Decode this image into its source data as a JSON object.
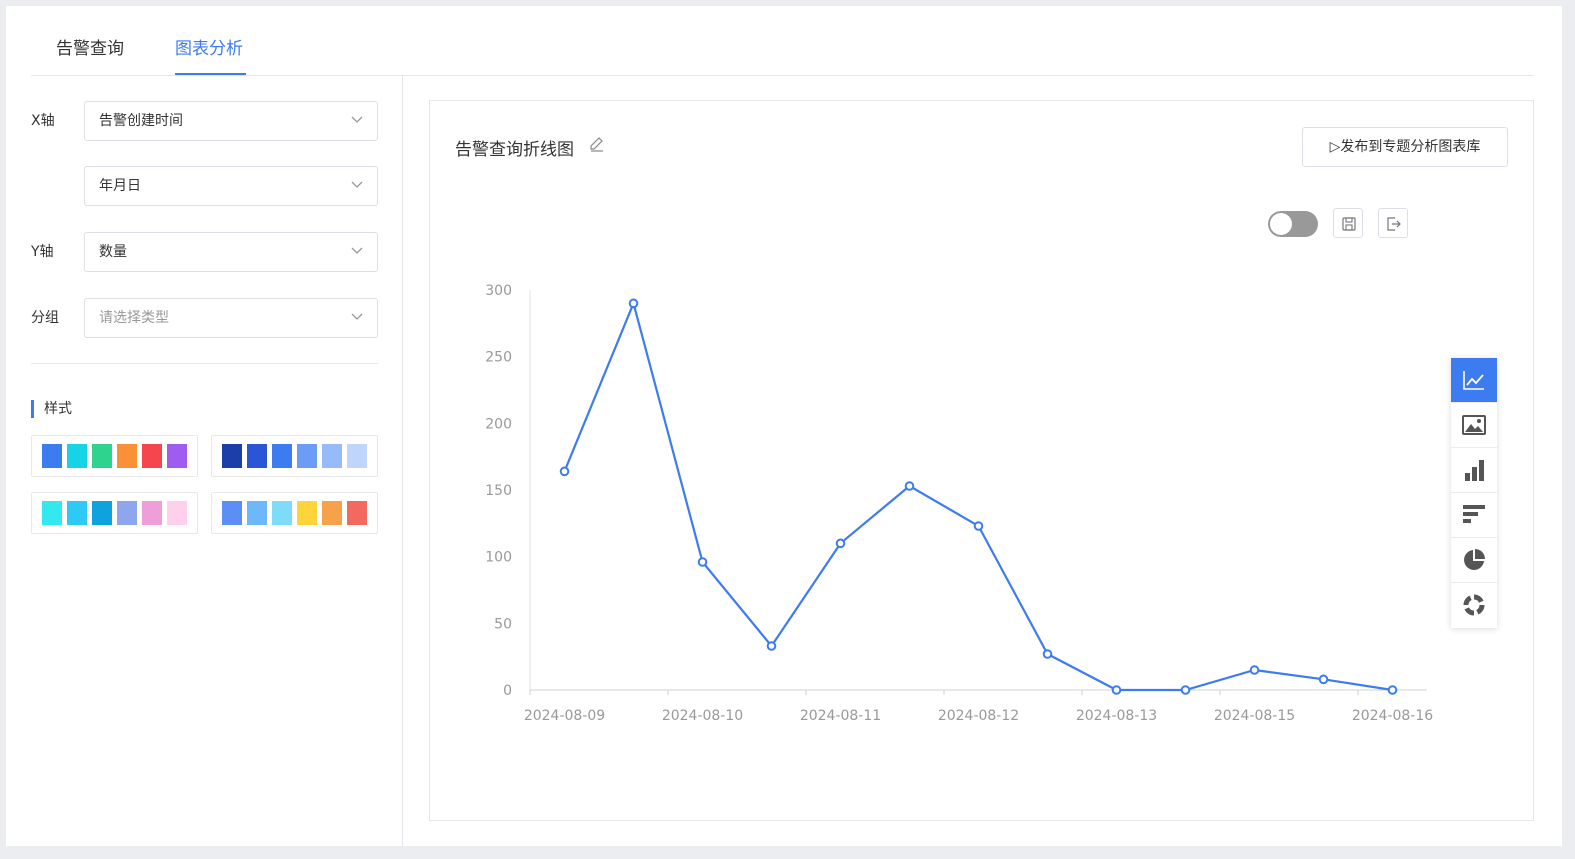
{
  "tabs": [
    {
      "label": "告警查询",
      "active": false
    },
    {
      "label": "图表分析",
      "active": true
    }
  ],
  "form": {
    "x_axis_label": "X轴",
    "x_axis_value": "告警创建时间",
    "x_axis_granularity": "年月日",
    "y_axis_label": "Y轴",
    "y_axis_value": "数量",
    "group_label": "分组",
    "group_placeholder": "请选择类型"
  },
  "style": {
    "title": "样式",
    "palettes": [
      [
        "#3d7bf0",
        "#16d3e6",
        "#2ed38e",
        "#fa9136",
        "#f6464d",
        "#a05bf0"
      ],
      [
        "#1b3ea8",
        "#2955d6",
        "#3d7bf0",
        "#6b9cf6",
        "#96bbf8",
        "#bfd5fb"
      ],
      [
        "#33e8ee",
        "#2fc9f5",
        "#0ea2de",
        "#8ea6ee",
        "#ee9fda",
        "#ffd0ec"
      ],
      [
        "#5b8ff5",
        "#6cb8fa",
        "#7fdcf8",
        "#fdd43a",
        "#f6a24a",
        "#f3685f"
      ]
    ]
  },
  "chart_panel": {
    "title": "告警查询折线图",
    "publish_label": "▷发布到专题分析图表库",
    "accent_color": "#3d7bf0"
  },
  "chart_types": [
    "line-chart-icon",
    "image-chart-icon",
    "bar-chart-icon",
    "horizontal-bar-icon",
    "pie-chart-icon",
    "donut-chart-icon"
  ],
  "chart_data": {
    "type": "line",
    "categories": [
      "2024-08-09",
      "2024-08-09b",
      "2024-08-10",
      "2024-08-10b",
      "2024-08-11",
      "2024-08-11b",
      "2024-08-12",
      "2024-08-12b",
      "2024-08-13",
      "2024-08-13b",
      "2024-08-15",
      "2024-08-15b",
      "2024-08-16"
    ],
    "tick_labels": [
      "2024-08-09",
      "2024-08-10",
      "2024-08-11",
      "2024-08-12",
      "2024-08-13",
      "2024-08-15",
      "2024-08-16"
    ],
    "values": [
      164,
      290,
      96,
      33,
      110,
      153,
      123,
      27,
      0,
      0,
      15,
      8,
      0
    ],
    "ylim": [
      0,
      300
    ],
    "yticks": [
      0,
      50,
      100,
      150,
      200,
      250,
      300
    ],
    "color": "#3d7bf0"
  }
}
